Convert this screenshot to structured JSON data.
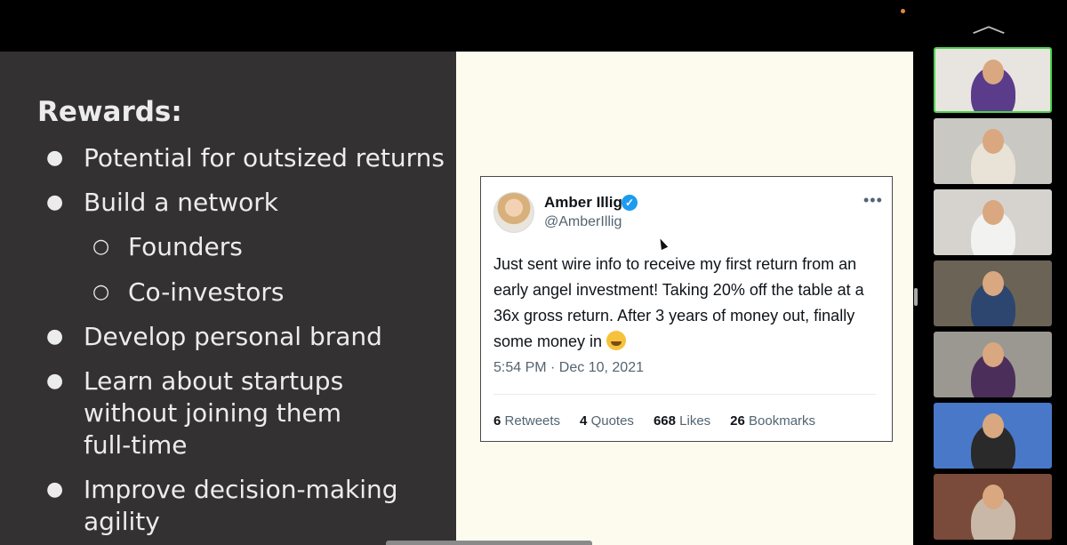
{
  "slide": {
    "title": "Rewards:",
    "bullets": [
      {
        "mark": "●",
        "text": "Potential for outsized returns"
      },
      {
        "mark": "●",
        "text": "Build a network"
      },
      {
        "mark": "○",
        "text": "Founders"
      },
      {
        "mark": "○",
        "text": "Co-investors"
      },
      {
        "mark": "●",
        "text": "Develop personal brand"
      },
      {
        "mark": "●",
        "text": "Learn about startups"
      },
      {
        "mark": "",
        "text": "without joining them"
      },
      {
        "mark": "",
        "text": "full-time"
      },
      {
        "mark": "●",
        "text": "Improve decision-making"
      },
      {
        "mark": "",
        "text": "agility"
      }
    ]
  },
  "tweet": {
    "author_name": "Amber Illig",
    "verified_mark": "✓",
    "handle": "@AmberIllig",
    "more": "•••",
    "text": "Just sent wire info to receive my first return from an early angel investment! Taking 20% off the table at a 36x gross return. After 3 years of money out, finally some money in",
    "emoji": "grinning-sweat-emoji",
    "timestamp": "5:54 PM · Dec 10, 2021",
    "stats": [
      {
        "count": "6",
        "label": "Retweets"
      },
      {
        "count": "4",
        "label": "Quotes"
      },
      {
        "count": "668",
        "label": "Likes"
      },
      {
        "count": "26",
        "label": "Bookmarks"
      }
    ]
  },
  "gallery": {
    "collapse_icon": "chevron-up-icon",
    "chevron": "︿",
    "tiles": [
      {
        "name": "participant-video-1",
        "bg": "#e8e4e0",
        "shirt": "#5a3c8a",
        "active": true
      },
      {
        "name": "participant-video-2",
        "bg": "#c9c8c2",
        "shirt": "#e9e2d6",
        "active": false
      },
      {
        "name": "participant-video-3",
        "bg": "#d6d3cf",
        "shirt": "#f2f2f0",
        "active": false
      },
      {
        "name": "participant-video-4",
        "bg": "#6b6355",
        "shirt": "#2d4670",
        "active": false
      },
      {
        "name": "participant-video-5",
        "bg": "#9a9890",
        "shirt": "#4b2e5a",
        "active": false
      },
      {
        "name": "participant-video-6",
        "bg": "#4a78c8",
        "shirt": "#2a2a2a",
        "active": false
      },
      {
        "name": "participant-video-7",
        "bg": "#7a4a3a",
        "shirt": "#c9b8a8",
        "active": false
      }
    ]
  },
  "colors": {
    "active_speaker": "#4fd24f",
    "verified": "#1d9bf0",
    "slide_dark": "#333131",
    "slide_light": "#fdfbee"
  }
}
